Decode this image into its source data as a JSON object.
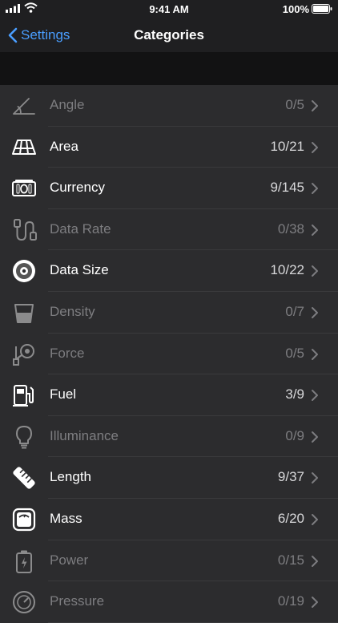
{
  "status_bar": {
    "time": "9:41 AM",
    "battery": "100%"
  },
  "nav": {
    "back_label": "Settings",
    "title": "Categories"
  },
  "categories": [
    {
      "label": "Angle",
      "count": "0/5",
      "enabled": false,
      "icon": "angle-icon"
    },
    {
      "label": "Area",
      "count": "10/21",
      "enabled": true,
      "icon": "area-icon"
    },
    {
      "label": "Currency",
      "count": "9/145",
      "enabled": true,
      "icon": "currency-icon"
    },
    {
      "label": "Data Rate",
      "count": "0/38",
      "enabled": false,
      "icon": "data-rate-icon"
    },
    {
      "label": "Data Size",
      "count": "10/22",
      "enabled": true,
      "icon": "data-size-icon"
    },
    {
      "label": "Density",
      "count": "0/7",
      "enabled": false,
      "icon": "density-icon"
    },
    {
      "label": "Force",
      "count": "0/5",
      "enabled": false,
      "icon": "force-icon"
    },
    {
      "label": "Fuel",
      "count": "3/9",
      "enabled": true,
      "icon": "fuel-icon"
    },
    {
      "label": "Illuminance",
      "count": "0/9",
      "enabled": false,
      "icon": "illuminance-icon"
    },
    {
      "label": "Length",
      "count": "9/37",
      "enabled": true,
      "icon": "length-icon"
    },
    {
      "label": "Mass",
      "count": "6/20",
      "enabled": true,
      "icon": "mass-icon"
    },
    {
      "label": "Power",
      "count": "0/15",
      "enabled": false,
      "icon": "power-icon"
    },
    {
      "label": "Pressure",
      "count": "0/19",
      "enabled": false,
      "icon": "pressure-icon"
    }
  ]
}
